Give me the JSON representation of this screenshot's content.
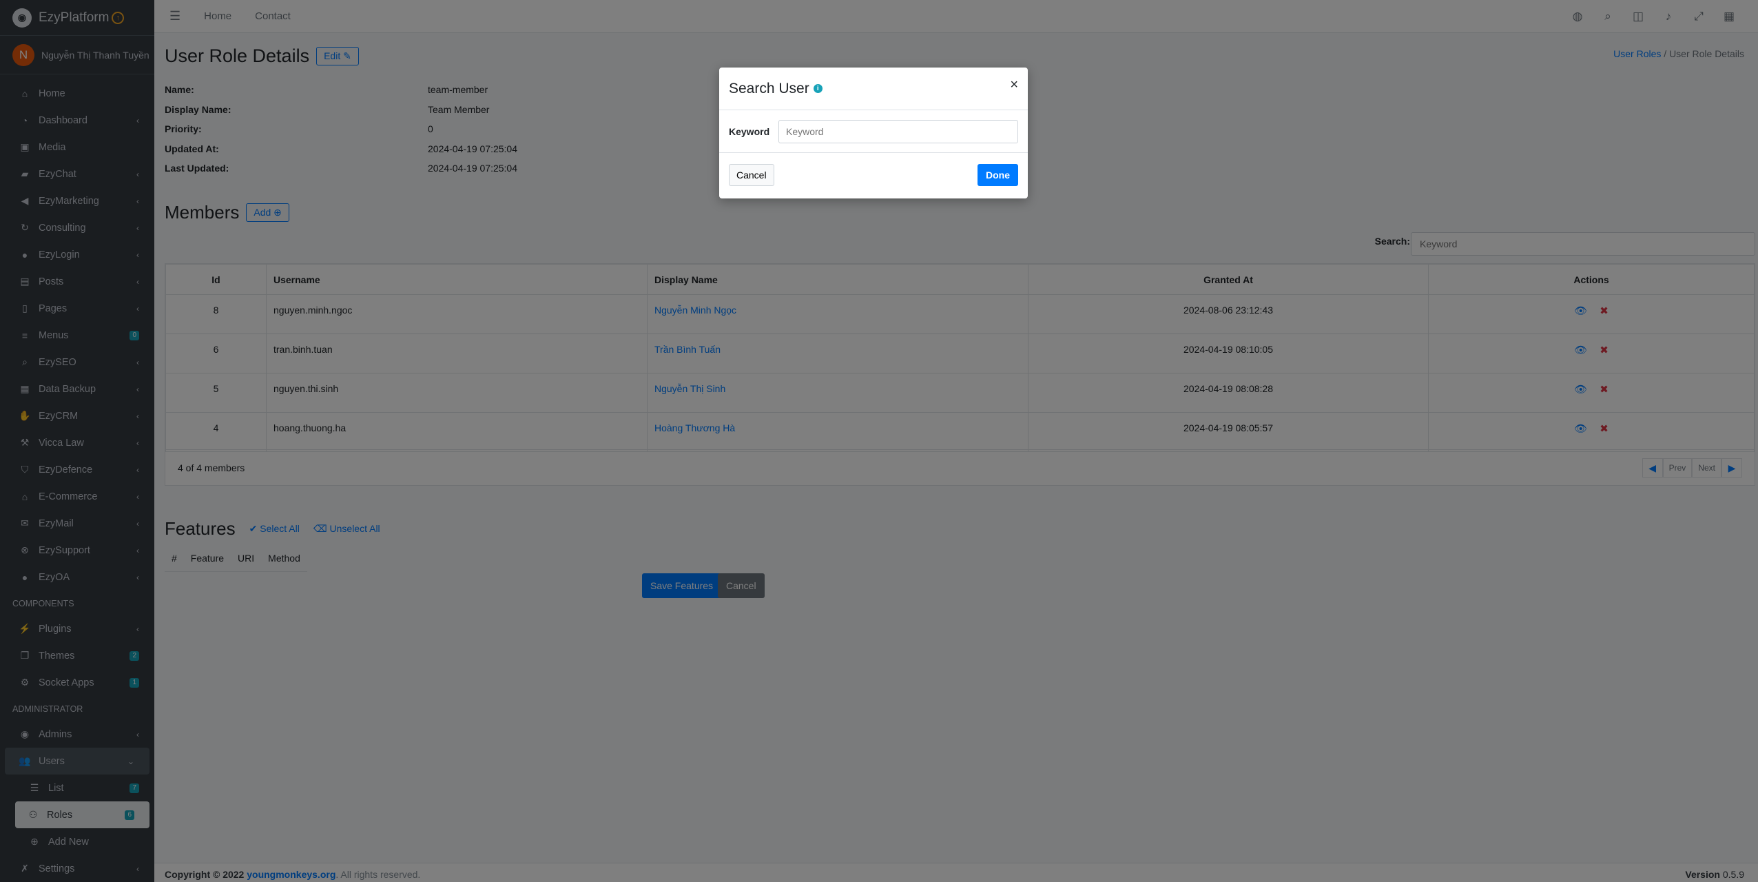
{
  "brand": {
    "name": "EzyPlatform"
  },
  "user": {
    "initial": "N",
    "name": "Nguyễn Thị Thanh Tuyền"
  },
  "sidebar": {
    "items": [
      {
        "label": "Home",
        "icon": "home-icon"
      },
      {
        "label": "Dashboard",
        "icon": "dashboard-icon"
      },
      {
        "label": "Media",
        "icon": "image-icon"
      },
      {
        "label": "EzyChat",
        "icon": "chat-icon"
      },
      {
        "label": "EzyMarketing",
        "icon": "megaphone-icon"
      },
      {
        "label": "Consulting",
        "icon": "sync-icon"
      },
      {
        "label": "EzyLogin",
        "icon": "user-lock-icon"
      },
      {
        "label": "Posts",
        "icon": "newspaper-icon"
      },
      {
        "label": "Pages",
        "icon": "file-icon"
      },
      {
        "label": "Menus",
        "icon": "bars-icon",
        "badge": "0"
      },
      {
        "label": "EzySEO",
        "icon": "search-icon"
      },
      {
        "label": "Data Backup",
        "icon": "database-icon"
      },
      {
        "label": "EzyCRM",
        "icon": "handshake-icon"
      },
      {
        "label": "Vicca Law",
        "icon": "gavel-icon"
      },
      {
        "label": "EzyDefence",
        "icon": "shield-icon"
      },
      {
        "label": "E-Commerce",
        "icon": "shop-icon"
      },
      {
        "label": "EzyMail",
        "icon": "mail-icon"
      },
      {
        "label": "EzySupport",
        "icon": "support-icon"
      },
      {
        "label": "EzyOA",
        "icon": "circle-icon"
      }
    ],
    "components_header": "COMPONENTS",
    "components": [
      {
        "label": "Plugins",
        "icon": "plug-icon"
      },
      {
        "label": "Themes",
        "icon": "copy-icon",
        "badge": "2"
      },
      {
        "label": "Socket Apps",
        "icon": "socket-icon",
        "badge": "1"
      }
    ],
    "admin_header": "ADMINISTRATOR",
    "admin": [
      {
        "label": "Admins",
        "icon": "user-circle-icon"
      },
      {
        "label": "Users",
        "icon": "users-icon"
      },
      {
        "label": "List",
        "icon": "list-icon",
        "badge": "7"
      },
      {
        "label": "Roles",
        "icon": "user-tag-icon",
        "badge": "6"
      },
      {
        "label": "Add New",
        "icon": "plus-circle-icon"
      },
      {
        "label": "Settings",
        "icon": "tools-icon"
      }
    ]
  },
  "topnav": {
    "home": "Home",
    "contact": "Contact"
  },
  "page": {
    "title": "User Role Details",
    "edit_label": "Edit",
    "breadcrumb": {
      "parent": "User Roles",
      "current": "User Role Details"
    },
    "details": [
      {
        "k": "Name:",
        "v": "team-member"
      },
      {
        "k": "Display Name:",
        "v": "Team Member"
      },
      {
        "k": "Priority:",
        "v": "0"
      },
      {
        "k": "Updated At:",
        "v": "2024-04-19 07:25:04"
      },
      {
        "k": "Last Updated:",
        "v": "2024-04-19 07:25:04"
      }
    ]
  },
  "members": {
    "title": "Members",
    "add_label": "Add",
    "search_label": "Search:",
    "search_placeholder": "Keyword",
    "columns": [
      "Id",
      "Username",
      "Display Name",
      "Granted At",
      "Actions"
    ],
    "rows": [
      {
        "id": "8",
        "username": "nguyen.minh.ngoc",
        "display": "Nguyễn Minh Ngọc",
        "granted": "2024-08-06 23:12:43"
      },
      {
        "id": "6",
        "username": "tran.binh.tuan",
        "display": "Trần Bình Tuấn",
        "granted": "2024-04-19 08:10:05"
      },
      {
        "id": "5",
        "username": "nguyen.thi.sinh",
        "display": "Nguyễn Thị Sinh",
        "granted": "2024-04-19 08:08:28"
      },
      {
        "id": "4",
        "username": "hoang.thuong.ha",
        "display": "Hoàng Thương Hà",
        "granted": "2024-04-19 08:05:57"
      }
    ],
    "summary": "4 of 4 members",
    "prev": "Prev",
    "next": "Next"
  },
  "features": {
    "title": "Features",
    "select_all": "Select All",
    "unselect_all": "Unselect All",
    "columns": [
      "#",
      "Feature",
      "URI",
      "Method"
    ],
    "save_label": "Save Features",
    "cancel_label": "Cancel"
  },
  "footer": {
    "copyright": "Copyright © 2022",
    "link": "youngmonkeys.org",
    "rights": ". All rights reserved.",
    "version_label": "Version",
    "version": "0.5.9"
  },
  "modal": {
    "title": "Search User",
    "keyword_label": "Keyword",
    "keyword_placeholder": "Keyword",
    "cancel_label": "Cancel",
    "done_label": "Done"
  }
}
